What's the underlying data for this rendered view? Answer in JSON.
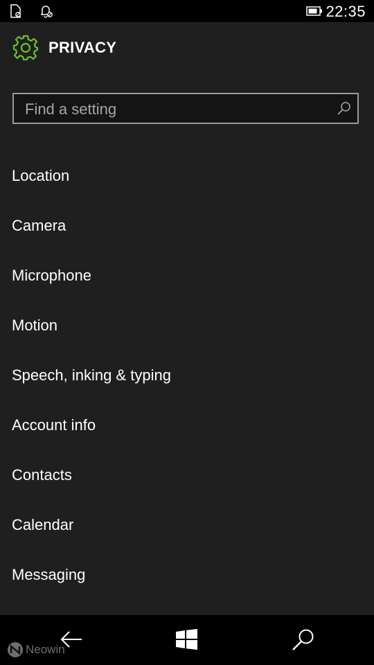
{
  "status_bar": {
    "time": "22:35",
    "icons": [
      "sim-icon",
      "alarm-icon",
      "battery-icon"
    ]
  },
  "header": {
    "title": "PRIVACY",
    "icon": "gear-icon",
    "accent_color": "#6fbf2a"
  },
  "search": {
    "placeholder": "Find a setting",
    "value": ""
  },
  "menu": {
    "items": [
      {
        "label": "Location"
      },
      {
        "label": "Camera"
      },
      {
        "label": "Microphone"
      },
      {
        "label": "Motion"
      },
      {
        "label": "Speech, inking & typing"
      },
      {
        "label": "Account info"
      },
      {
        "label": "Contacts"
      },
      {
        "label": "Calendar"
      },
      {
        "label": "Messaging"
      }
    ]
  },
  "nav_bar": {
    "buttons": [
      "back-icon",
      "windows-icon",
      "search-icon"
    ]
  },
  "watermark": {
    "text": "Neowin"
  }
}
